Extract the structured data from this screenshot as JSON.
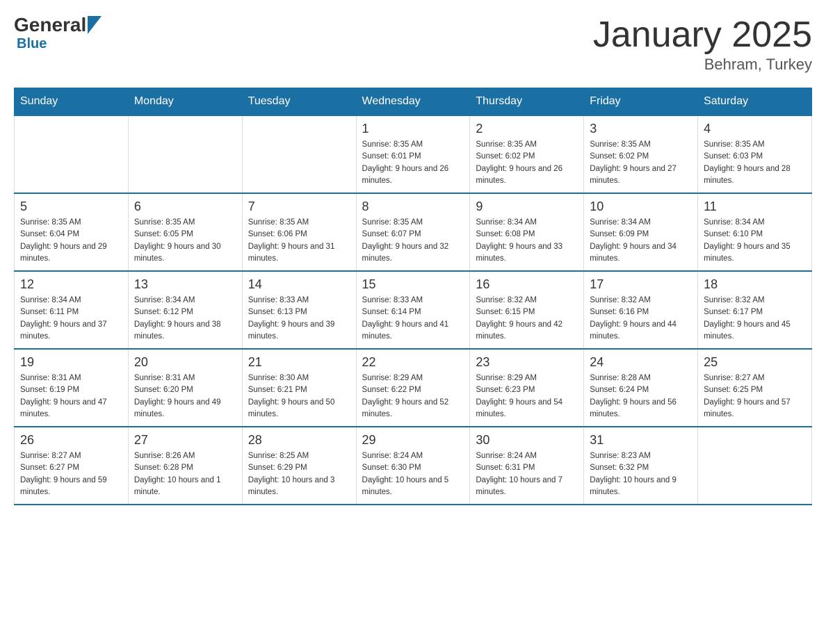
{
  "header": {
    "logo_general": "General",
    "logo_blue": "Blue",
    "logo_sub": "Blue",
    "title": "January 2025",
    "location": "Behram, Turkey"
  },
  "calendar": {
    "days_of_week": [
      "Sunday",
      "Monday",
      "Tuesday",
      "Wednesday",
      "Thursday",
      "Friday",
      "Saturday"
    ],
    "weeks": [
      [
        {
          "day": "",
          "info": ""
        },
        {
          "day": "",
          "info": ""
        },
        {
          "day": "",
          "info": ""
        },
        {
          "day": "1",
          "info": "Sunrise: 8:35 AM\nSunset: 6:01 PM\nDaylight: 9 hours and 26 minutes."
        },
        {
          "day": "2",
          "info": "Sunrise: 8:35 AM\nSunset: 6:02 PM\nDaylight: 9 hours and 26 minutes."
        },
        {
          "day": "3",
          "info": "Sunrise: 8:35 AM\nSunset: 6:02 PM\nDaylight: 9 hours and 27 minutes."
        },
        {
          "day": "4",
          "info": "Sunrise: 8:35 AM\nSunset: 6:03 PM\nDaylight: 9 hours and 28 minutes."
        }
      ],
      [
        {
          "day": "5",
          "info": "Sunrise: 8:35 AM\nSunset: 6:04 PM\nDaylight: 9 hours and 29 minutes."
        },
        {
          "day": "6",
          "info": "Sunrise: 8:35 AM\nSunset: 6:05 PM\nDaylight: 9 hours and 30 minutes."
        },
        {
          "day": "7",
          "info": "Sunrise: 8:35 AM\nSunset: 6:06 PM\nDaylight: 9 hours and 31 minutes."
        },
        {
          "day": "8",
          "info": "Sunrise: 8:35 AM\nSunset: 6:07 PM\nDaylight: 9 hours and 32 minutes."
        },
        {
          "day": "9",
          "info": "Sunrise: 8:34 AM\nSunset: 6:08 PM\nDaylight: 9 hours and 33 minutes."
        },
        {
          "day": "10",
          "info": "Sunrise: 8:34 AM\nSunset: 6:09 PM\nDaylight: 9 hours and 34 minutes."
        },
        {
          "day": "11",
          "info": "Sunrise: 8:34 AM\nSunset: 6:10 PM\nDaylight: 9 hours and 35 minutes."
        }
      ],
      [
        {
          "day": "12",
          "info": "Sunrise: 8:34 AM\nSunset: 6:11 PM\nDaylight: 9 hours and 37 minutes."
        },
        {
          "day": "13",
          "info": "Sunrise: 8:34 AM\nSunset: 6:12 PM\nDaylight: 9 hours and 38 minutes."
        },
        {
          "day": "14",
          "info": "Sunrise: 8:33 AM\nSunset: 6:13 PM\nDaylight: 9 hours and 39 minutes."
        },
        {
          "day": "15",
          "info": "Sunrise: 8:33 AM\nSunset: 6:14 PM\nDaylight: 9 hours and 41 minutes."
        },
        {
          "day": "16",
          "info": "Sunrise: 8:32 AM\nSunset: 6:15 PM\nDaylight: 9 hours and 42 minutes."
        },
        {
          "day": "17",
          "info": "Sunrise: 8:32 AM\nSunset: 6:16 PM\nDaylight: 9 hours and 44 minutes."
        },
        {
          "day": "18",
          "info": "Sunrise: 8:32 AM\nSunset: 6:17 PM\nDaylight: 9 hours and 45 minutes."
        }
      ],
      [
        {
          "day": "19",
          "info": "Sunrise: 8:31 AM\nSunset: 6:19 PM\nDaylight: 9 hours and 47 minutes."
        },
        {
          "day": "20",
          "info": "Sunrise: 8:31 AM\nSunset: 6:20 PM\nDaylight: 9 hours and 49 minutes."
        },
        {
          "day": "21",
          "info": "Sunrise: 8:30 AM\nSunset: 6:21 PM\nDaylight: 9 hours and 50 minutes."
        },
        {
          "day": "22",
          "info": "Sunrise: 8:29 AM\nSunset: 6:22 PM\nDaylight: 9 hours and 52 minutes."
        },
        {
          "day": "23",
          "info": "Sunrise: 8:29 AM\nSunset: 6:23 PM\nDaylight: 9 hours and 54 minutes."
        },
        {
          "day": "24",
          "info": "Sunrise: 8:28 AM\nSunset: 6:24 PM\nDaylight: 9 hours and 56 minutes."
        },
        {
          "day": "25",
          "info": "Sunrise: 8:27 AM\nSunset: 6:25 PM\nDaylight: 9 hours and 57 minutes."
        }
      ],
      [
        {
          "day": "26",
          "info": "Sunrise: 8:27 AM\nSunset: 6:27 PM\nDaylight: 9 hours and 59 minutes."
        },
        {
          "day": "27",
          "info": "Sunrise: 8:26 AM\nSunset: 6:28 PM\nDaylight: 10 hours and 1 minute."
        },
        {
          "day": "28",
          "info": "Sunrise: 8:25 AM\nSunset: 6:29 PM\nDaylight: 10 hours and 3 minutes."
        },
        {
          "day": "29",
          "info": "Sunrise: 8:24 AM\nSunset: 6:30 PM\nDaylight: 10 hours and 5 minutes."
        },
        {
          "day": "30",
          "info": "Sunrise: 8:24 AM\nSunset: 6:31 PM\nDaylight: 10 hours and 7 minutes."
        },
        {
          "day": "31",
          "info": "Sunrise: 8:23 AM\nSunset: 6:32 PM\nDaylight: 10 hours and 9 minutes."
        },
        {
          "day": "",
          "info": ""
        }
      ]
    ]
  }
}
